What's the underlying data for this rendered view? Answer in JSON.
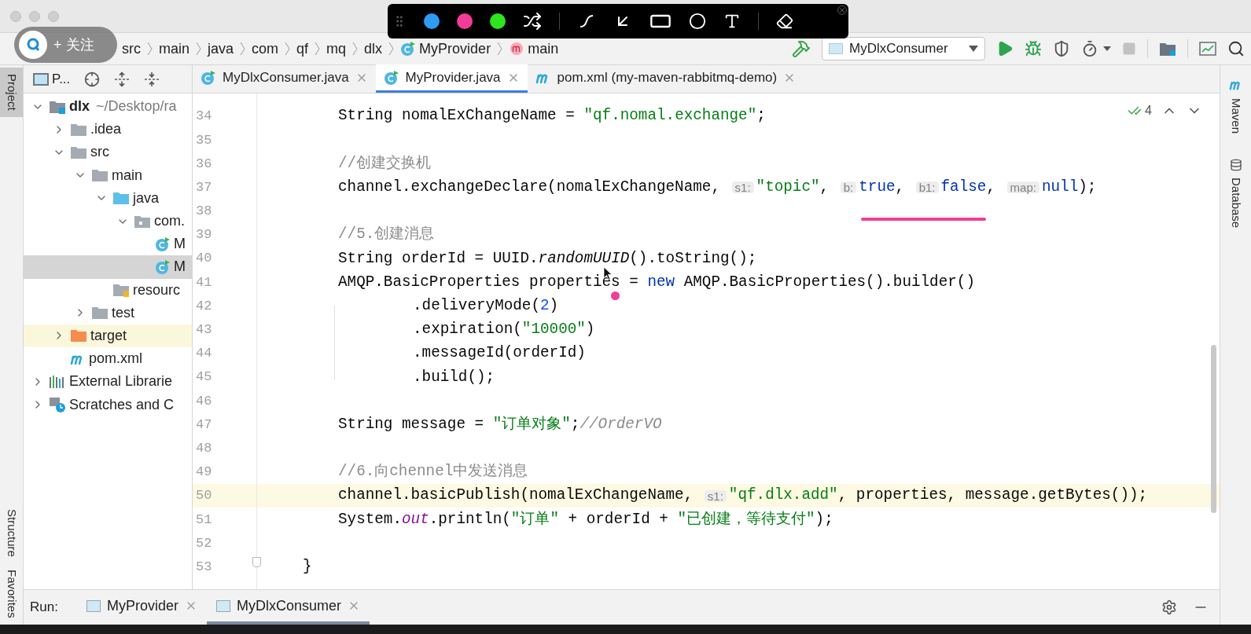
{
  "follow_badge": {
    "label": "+ 关注"
  },
  "breadcrumbs": [
    {
      "label": "src",
      "kind": "folder"
    },
    {
      "label": "main",
      "kind": "folder"
    },
    {
      "label": "java",
      "kind": "folder"
    },
    {
      "label": "com",
      "kind": "folder"
    },
    {
      "label": "qf",
      "kind": "folder"
    },
    {
      "label": "mq",
      "kind": "folder"
    },
    {
      "label": "dlx",
      "kind": "folder"
    },
    {
      "label": "MyProvider",
      "kind": "class"
    },
    {
      "label": "main",
      "kind": "method"
    }
  ],
  "annotation_toolbar": {
    "tools": [
      {
        "kind": "color",
        "color": "#2d9cf4"
      },
      {
        "kind": "color",
        "color": "#f23d97"
      },
      {
        "kind": "color",
        "color": "#2ee51e"
      },
      {
        "kind": "shuffle"
      },
      {
        "kind": "divider"
      },
      {
        "kind": "curve"
      },
      {
        "kind": "arrow"
      },
      {
        "kind": "rectangle"
      },
      {
        "kind": "ellipse"
      },
      {
        "kind": "text"
      },
      {
        "kind": "divider"
      },
      {
        "kind": "eraser"
      }
    ]
  },
  "run_configuration": {
    "label": "MyDlxConsumer"
  },
  "project_panel": {
    "title": "P...",
    "tree": [
      {
        "label": "dlx",
        "suffix": "~/Desktop/ra",
        "kind": "module",
        "expanded": true,
        "selected": false,
        "children": [
          {
            "label": ".idea",
            "kind": "folder",
            "expanded": false,
            "selected": false
          },
          {
            "label": "src",
            "kind": "folder",
            "expanded": true,
            "selected": false,
            "children": [
              {
                "label": "main",
                "kind": "folder",
                "expanded": true,
                "selected": false,
                "children": [
                  {
                    "label": "java",
                    "kind": "source",
                    "expanded": true,
                    "selected": false,
                    "children": [
                      {
                        "label": "com.",
                        "kind": "package",
                        "expanded": true,
                        "selected": false,
                        "children": [
                          {
                            "label": "M",
                            "kind": "class",
                            "selected": false
                          },
                          {
                            "label": "M",
                            "kind": "class",
                            "selected": true
                          }
                        ]
                      }
                    ]
                  },
                  {
                    "label": "resourc",
                    "kind": "resources",
                    "selected": false
                  }
                ]
              },
              {
                "label": "test",
                "kind": "folder",
                "expanded": false,
                "selected": false
              }
            ]
          },
          {
            "label": "target",
            "kind": "excluded",
            "expanded": false,
            "selected": false
          },
          {
            "label": "pom.xml",
            "kind": "maven",
            "selected": false
          }
        ]
      },
      {
        "label": "External Librarie",
        "kind": "libraries",
        "expanded": false,
        "selected": false
      },
      {
        "label": "Scratches and C",
        "kind": "scratches",
        "expanded": false,
        "selected": false
      }
    ]
  },
  "editor_tabs": [
    {
      "label": "MyDlxConsumer.java",
      "kind": "class",
      "selected": false
    },
    {
      "label": "MyProvider.java",
      "kind": "class",
      "selected": true
    },
    {
      "label": "pom.xml (my-maven-rabbitmq-demo)",
      "kind": "maven",
      "selected": false
    }
  ],
  "inspection": {
    "count": "4"
  },
  "code": [
    {
      "number": "34",
      "kind": "body",
      "current": false,
      "tokens": [
        {
          "kind": "plain",
          "text": "String nomalExChangeName = "
        },
        {
          "kind": "string",
          "text": "\"qf.nomal.exchange\""
        },
        {
          "kind": "plain",
          "text": ";"
        }
      ]
    },
    {
      "number": "35",
      "kind": "empty",
      "current": false
    },
    {
      "number": "36",
      "kind": "body",
      "current": false,
      "tokens": [
        {
          "kind": "comment",
          "text": "//创建交换机"
        }
      ]
    },
    {
      "number": "37",
      "kind": "body",
      "current": false,
      "tokens": [
        {
          "kind": "plain",
          "text": "channel.exchangeDeclare(nomalExChangeName, "
        },
        {
          "kind": "hint",
          "text": "s1:"
        },
        {
          "kind": "string",
          "text": "\"topic\""
        },
        {
          "kind": "plain",
          "text": ", "
        },
        {
          "kind": "hint",
          "text": "b:"
        },
        {
          "kind": "keyword",
          "text": "true"
        },
        {
          "kind": "plain",
          "text": ", "
        },
        {
          "kind": "hint",
          "text": "b1:"
        },
        {
          "kind": "keyword",
          "text": "false"
        },
        {
          "kind": "plain",
          "text": ", "
        },
        {
          "kind": "hint",
          "text": "map:"
        },
        {
          "kind": "keyword",
          "text": "null"
        },
        {
          "kind": "plain",
          "text": ");"
        }
      ]
    },
    {
      "number": "38",
      "kind": "empty",
      "current": false
    },
    {
      "number": "39",
      "kind": "body",
      "current": false,
      "tokens": [
        {
          "kind": "comment",
          "text": "//5.创建消息"
        }
      ]
    },
    {
      "number": "40",
      "kind": "body",
      "current": false,
      "tokens": [
        {
          "kind": "plain",
          "text": "String orderId = UUID."
        },
        {
          "kind": "italic",
          "text": "randomUUID"
        },
        {
          "kind": "plain",
          "text": "().toString();"
        }
      ]
    },
    {
      "number": "41",
      "kind": "body",
      "current": false,
      "tokens": [
        {
          "kind": "plain",
          "text": "AMQP.BasicProperties properties = "
        },
        {
          "kind": "keyword",
          "text": "new"
        },
        {
          "kind": "plain",
          "text": " AMQP.BasicProperties().builder()"
        }
      ]
    },
    {
      "number": "42",
      "kind": "chain",
      "current": false,
      "tokens": [
        {
          "kind": "plain",
          "text": ".deliveryMode("
        },
        {
          "kind": "number",
          "text": "2"
        },
        {
          "kind": "plain",
          "text": ")"
        }
      ]
    },
    {
      "number": "43",
      "kind": "chain",
      "current": false,
      "tokens": [
        {
          "kind": "plain",
          "text": ".expiration("
        },
        {
          "kind": "string",
          "text": "\"10000\""
        },
        {
          "kind": "plain",
          "text": ")"
        }
      ]
    },
    {
      "number": "44",
      "kind": "chain",
      "current": false,
      "tokens": [
        {
          "kind": "plain",
          "text": ".messageId(orderId)"
        }
      ]
    },
    {
      "number": "45",
      "kind": "chain",
      "current": false,
      "tokens": [
        {
          "kind": "plain",
          "text": ".build();"
        }
      ]
    },
    {
      "number": "46",
      "kind": "empty",
      "current": false
    },
    {
      "number": "47",
      "kind": "body",
      "current": false,
      "tokens": [
        {
          "kind": "plain",
          "text": "String message = "
        },
        {
          "kind": "string",
          "text": "\"订单对象\""
        },
        {
          "kind": "plain",
          "text": ";"
        },
        {
          "kind": "doc",
          "text": "//OrderVO"
        }
      ]
    },
    {
      "number": "48",
      "kind": "empty",
      "current": false
    },
    {
      "number": "49",
      "kind": "body",
      "current": false,
      "tokens": [
        {
          "kind": "comment",
          "text": "//6.向chennel中发送消息"
        }
      ]
    },
    {
      "number": "50",
      "kind": "body",
      "current": true,
      "tokens": [
        {
          "kind": "plain",
          "text": "channel.basicPublish(nomalExChangeName, "
        },
        {
          "kind": "hint",
          "text": "s1:"
        },
        {
          "kind": "string",
          "text": "\"qf.dlx.add\""
        },
        {
          "kind": "plain",
          "text": ", properties, message.getBytes());"
        }
      ]
    },
    {
      "number": "51",
      "kind": "body",
      "current": false,
      "tokens": [
        {
          "kind": "plain",
          "text": "System."
        },
        {
          "kind": "static",
          "text": "out"
        },
        {
          "kind": "plain",
          "text": ".println("
        },
        {
          "kind": "string",
          "text": "\"订单\""
        },
        {
          "kind": "plain",
          "text": " + orderId + "
        },
        {
          "kind": "string",
          "text": "\"已创建，等待支付\""
        },
        {
          "kind": "plain",
          "text": ");"
        }
      ]
    },
    {
      "number": "52",
      "kind": "empty",
      "current": false
    },
    {
      "number": "53",
      "kind": "close",
      "current": false,
      "tokens": [
        {
          "kind": "plain",
          "text": "}"
        }
      ]
    }
  ],
  "left_stripe": [
    {
      "label": "Project",
      "selected": true
    },
    {
      "label": "Structure",
      "selected": false
    },
    {
      "label": "Favorites",
      "selected": false
    }
  ],
  "right_stripe": [
    {
      "label": "Maven",
      "kind": "maven"
    },
    {
      "label": "Database",
      "kind": "database"
    }
  ],
  "run_bar": {
    "label": "Run:",
    "tabs": [
      {
        "label": "MyProvider",
        "selected": false
      },
      {
        "label": "MyDlxConsumer",
        "selected": true
      }
    ]
  }
}
